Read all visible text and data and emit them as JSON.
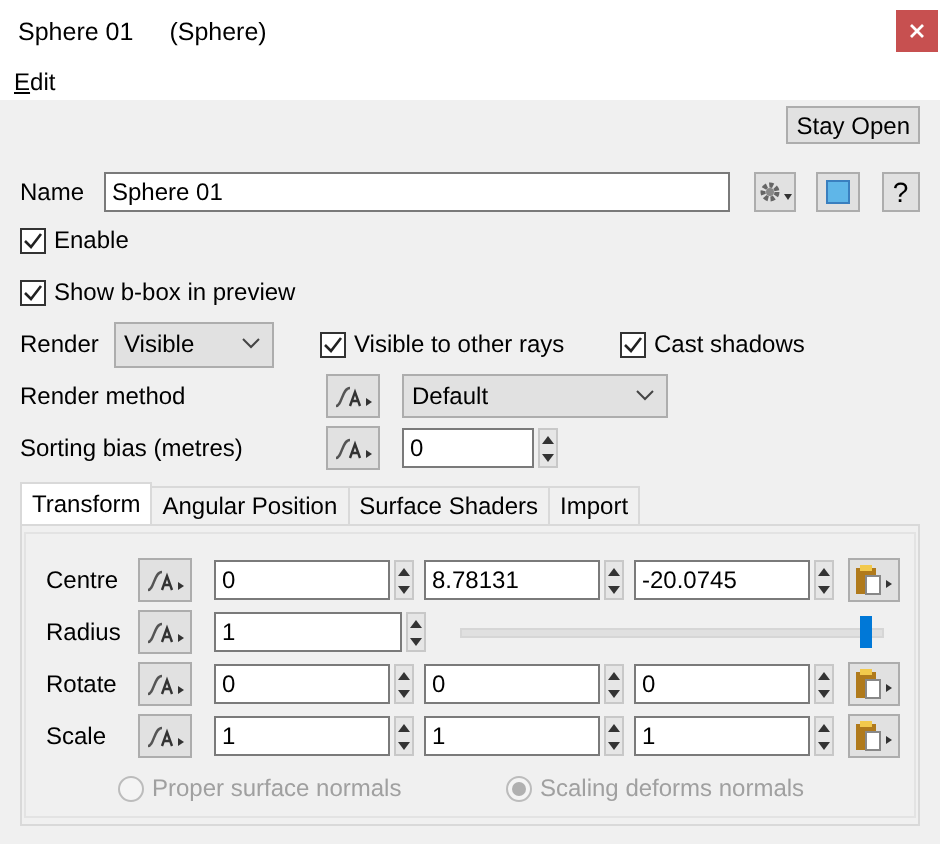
{
  "window": {
    "title": "Sphere 01",
    "subtitle": "(Sphere)"
  },
  "menu": [
    {
      "label": "Edit"
    }
  ],
  "stay_open_button": "Stay Open",
  "name": {
    "label": "Name",
    "value": "Sphere 01"
  },
  "help_button": "?",
  "options": [
    {
      "label": "Enable",
      "checked": true
    },
    {
      "label": "Show b-box in preview",
      "checked": true
    }
  ],
  "render": {
    "label": "Render",
    "value": "Visible",
    "checks": [
      {
        "label": "Visible to other rays",
        "checked": true
      },
      {
        "label": "Cast shadows",
        "checked": true
      }
    ]
  },
  "render_method": {
    "label": "Render method",
    "value": "Default"
  },
  "sorting_bias": {
    "label": "Sorting bias (metres)",
    "value": "0"
  },
  "tabs": [
    {
      "label": "Transform",
      "selected": true
    },
    {
      "label": "Angular Position",
      "selected": false
    },
    {
      "label": "Surface Shaders",
      "selected": false
    },
    {
      "label": "Import",
      "selected": false
    }
  ],
  "transform_rows": [
    {
      "label": "Centre",
      "kind": "vector",
      "values": [
        "0",
        "8.78131",
        "-20.0745"
      ]
    },
    {
      "label": "Radius",
      "kind": "slider",
      "value": "1",
      "level": 0.97
    },
    {
      "label": "Rotate",
      "kind": "vector",
      "values": [
        "0",
        "0",
        "0"
      ]
    },
    {
      "label": "Scale",
      "kind": "vector",
      "values": [
        "1",
        "1",
        "1"
      ]
    }
  ],
  "normals": [
    {
      "label": "Proper surface normals",
      "selected": false,
      "disabled": true
    },
    {
      "label": "Scaling deforms normals",
      "selected": true,
      "disabled": true
    }
  ]
}
